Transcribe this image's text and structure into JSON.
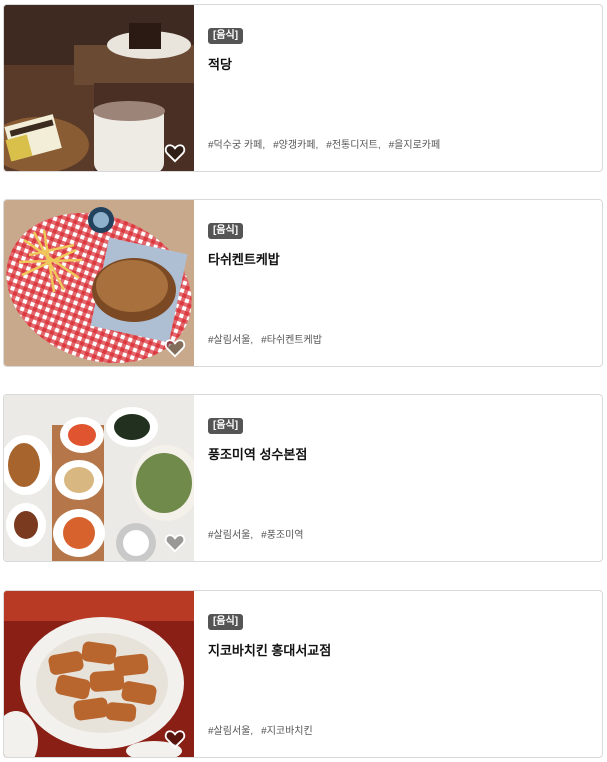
{
  "cards": [
    {
      "badge": "[음식]",
      "title": "적당",
      "tags": [
        "#덕수궁 카페,",
        "#양갱카페,",
        "#전통디저트,",
        "#을지로카페"
      ],
      "image": "cafe-dessert-photo"
    },
    {
      "badge": "[음식]",
      "title": "타쉬켄트케밥",
      "tags": [
        "#살림서울,",
        "#타쉬켄트케밥"
      ],
      "image": "kebab-fries-photo"
    },
    {
      "badge": "[음식]",
      "title": "풍조미역 성수본점",
      "tags": [
        "#살림서울,",
        "#풍조미역"
      ],
      "image": "seaweed-soup-meal-photo"
    },
    {
      "badge": "[음식]",
      "title": "지코바치킨 홍대서교점",
      "tags": [
        "#살림서울,",
        "#지코바치킨"
      ],
      "image": "grilled-chicken-photo"
    }
  ],
  "icons": {
    "favorite": "heart-outline-icon"
  }
}
